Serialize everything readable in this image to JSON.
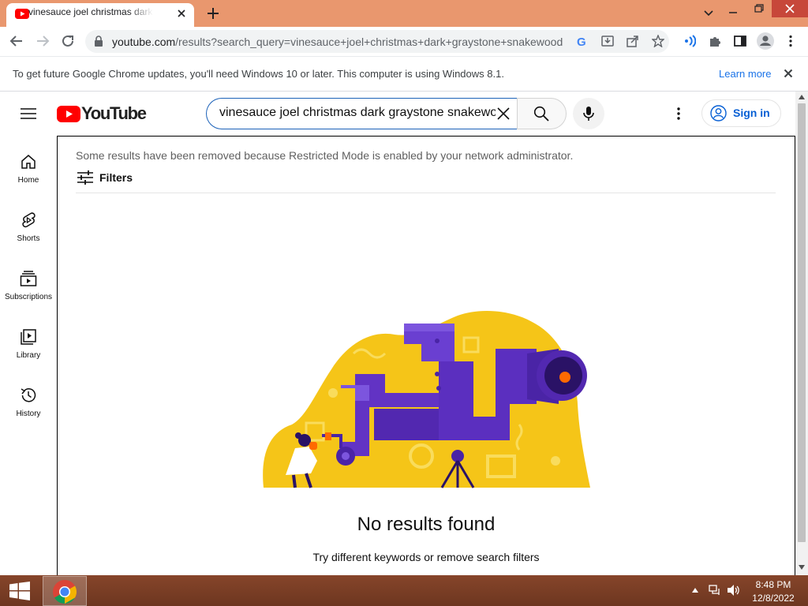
{
  "browser": {
    "tab_title": "vinesauce joel christmas dark graystone snakewood",
    "url_host": "youtube.com",
    "url_path": "/results?search_query=vinesauce+joel+christmas+dark+graystone+snakewood",
    "infobar_message": "To get future Google Chrome updates, you'll need Windows 10 or later. This computer is using Windows 8.1.",
    "infobar_link": "Learn more"
  },
  "youtube": {
    "logo_text": "YouTube",
    "search_query": "vinesauce joel christmas dark graystone snakewood",
    "sign_in_label": "Sign in",
    "nav": [
      {
        "label": "Home",
        "icon": "home-icon"
      },
      {
        "label": "Shorts",
        "icon": "shorts-icon"
      },
      {
        "label": "Subscriptions",
        "icon": "subscriptions-icon"
      },
      {
        "label": "Library",
        "icon": "library-icon"
      },
      {
        "label": "History",
        "icon": "history-icon"
      }
    ],
    "restricted_message": "Some results have been removed because Restricted Mode is enabled by your network administrator.",
    "filters_label": "Filters",
    "no_results_title": "No results found",
    "no_results_subtitle": "Try different keywords or remove search filters"
  },
  "taskbar": {
    "time": "8:48 PM",
    "date": "12/8/2022"
  },
  "colors": {
    "chrome_frame": "#e9976e",
    "youtube_red": "#ff0000",
    "link_blue": "#065fd4",
    "taskbar": "#7a3d24",
    "illustration_yellow": "#f5c518",
    "illustration_purple": "#6233c4"
  }
}
